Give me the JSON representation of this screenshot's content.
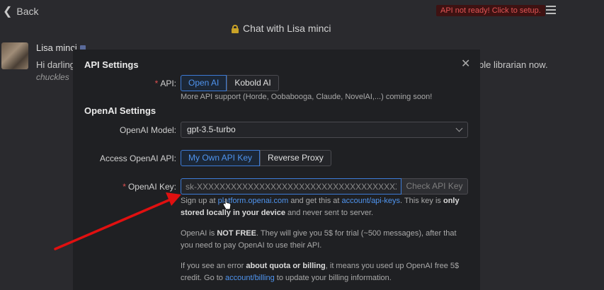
{
  "header": {
    "back_label": "Back",
    "api_warning": "API not ready! Click to setup.",
    "chat_title": "Chat with Lisa minci"
  },
  "message": {
    "sender": "Lisa minci",
    "text_left": "Hi darling",
    "text_left_line2": "chuckles",
    "text_right": "ble librarian now."
  },
  "modal": {
    "title": "API Settings",
    "api_label": "API:",
    "api_options": [
      "Open AI",
      "Kobold AI"
    ],
    "api_selected": "Open AI",
    "api_note": "More API support (Horde, Oobabooga, Claude, NovelAI,...) coming soon!",
    "openai_section_title": "OpenAI Settings",
    "model_label": "OpenAI Model:",
    "model_value": "gpt-3.5-turbo",
    "access_label": "Access OpenAI API:",
    "access_options": [
      "My Own API Key",
      "Reverse Proxy"
    ],
    "access_selected": "My Own API Key",
    "key_label": "OpenAI Key:",
    "key_placeholder": "sk-XXXXXXXXXXXXXXXXXXXXXXXXXXXXXXXXXXXXXXXXXXXXXXXX",
    "check_button": "Check API Key",
    "signup_text_1": "Sign up at ",
    "signup_link_1": "platform.openai.com",
    "signup_text_2": " and get this at ",
    "signup_link_2": "account/api-keys",
    "signup_text_3": ". This key is ",
    "signup_bold": "only stored locally in your device",
    "signup_text_4": " and never sent to server.",
    "free_text_1": "OpenAI is ",
    "free_bold": "NOT FREE",
    "free_text_2": ". They will give you 5$ for trial (~500 messages), after that you need to pay OpenAI to use their API.",
    "quota_text_1": "If you see an error ",
    "quota_bold": "about quota or billing",
    "quota_text_2": ", it means you used up OpenAI free 5$ credit. Go to ",
    "quota_link": "account/billing",
    "quota_text_3": " to update your billing information."
  },
  "colors": {
    "accent": "#3d7bd6",
    "warning": "#e25555",
    "annotation_arrow": "#e01010"
  },
  "icons": [
    "chevron-left-icon",
    "hamburger-menu-icon",
    "lock-icon",
    "close-icon",
    "chevron-down-icon",
    "hand-cursor-icon"
  ]
}
